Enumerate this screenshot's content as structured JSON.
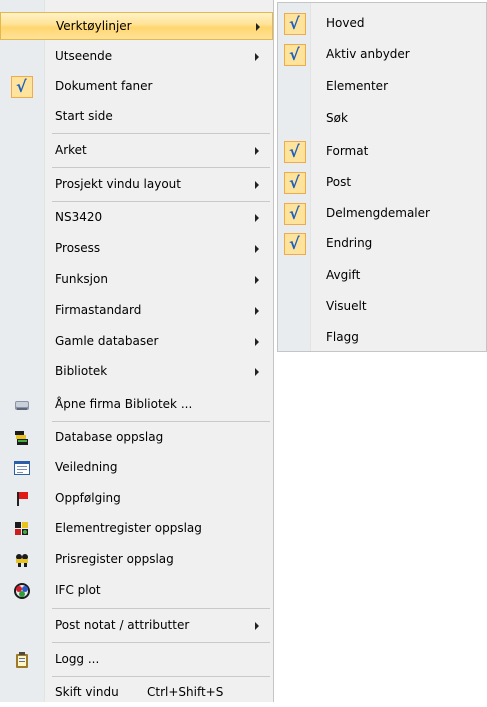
{
  "menu": {
    "items": [
      {
        "label": "Verktøylinjer",
        "submenu": true,
        "highlight": true
      },
      {
        "label": "Utseende",
        "submenu": true
      },
      {
        "label": "Dokument faner",
        "checked": true
      },
      {
        "label": "Start side"
      },
      {
        "label": "Arket",
        "submenu": true
      },
      {
        "label": "Prosjekt vindu layout",
        "submenu": true
      },
      {
        "label": "NS3420",
        "submenu": true
      },
      {
        "label": "Prosess",
        "submenu": true
      },
      {
        "label": "Funksjon",
        "submenu": true
      },
      {
        "label": "Firmastandard",
        "submenu": true
      },
      {
        "label": "Gamle databaser",
        "submenu": true
      },
      {
        "label": "Bibliotek",
        "submenu": true
      },
      {
        "label": "Åpne firma Bibliotek ...",
        "icon": "library-book-icon"
      },
      {
        "label": "Database oppslag",
        "icon": "database-lookup-icon"
      },
      {
        "label": "Veiledning",
        "icon": "guide-icon"
      },
      {
        "label": "Oppfølging",
        "icon": "red-flag-icon"
      },
      {
        "label": "Elementregister oppslag",
        "icon": "element-register-icon"
      },
      {
        "label": "Prisregister oppslag",
        "icon": "price-register-icon"
      },
      {
        "label": "IFC plot",
        "icon": "ifc-plot-icon"
      },
      {
        "label": "Post notat / attributter",
        "submenu": true
      },
      {
        "label": "Logg ...",
        "icon": "clipboard-log-icon"
      },
      {
        "label": "Skift vindu",
        "shortcut": "Ctrl+Shift+S"
      }
    ]
  },
  "submenu": {
    "items": [
      {
        "label": "Hoved",
        "checked": true
      },
      {
        "label": "Aktiv anbyder",
        "checked": true
      },
      {
        "label": "Elementer",
        "checked": false
      },
      {
        "label": "Søk",
        "checked": false
      },
      {
        "label": "Format",
        "checked": true
      },
      {
        "label": "Post",
        "checked": true
      },
      {
        "label": "Delmengdemaler",
        "checked": true
      },
      {
        "label": "Endring",
        "checked": true
      },
      {
        "label": "Avgift",
        "checked": false
      },
      {
        "label": "Visuelt",
        "checked": false
      },
      {
        "label": "Flagg",
        "checked": false
      }
    ]
  },
  "glyphs": {
    "checkmark": "√"
  },
  "colors": {
    "highlight": "#ffe294",
    "check_bg": "#fde39c",
    "check_border": "#f0a94b"
  }
}
